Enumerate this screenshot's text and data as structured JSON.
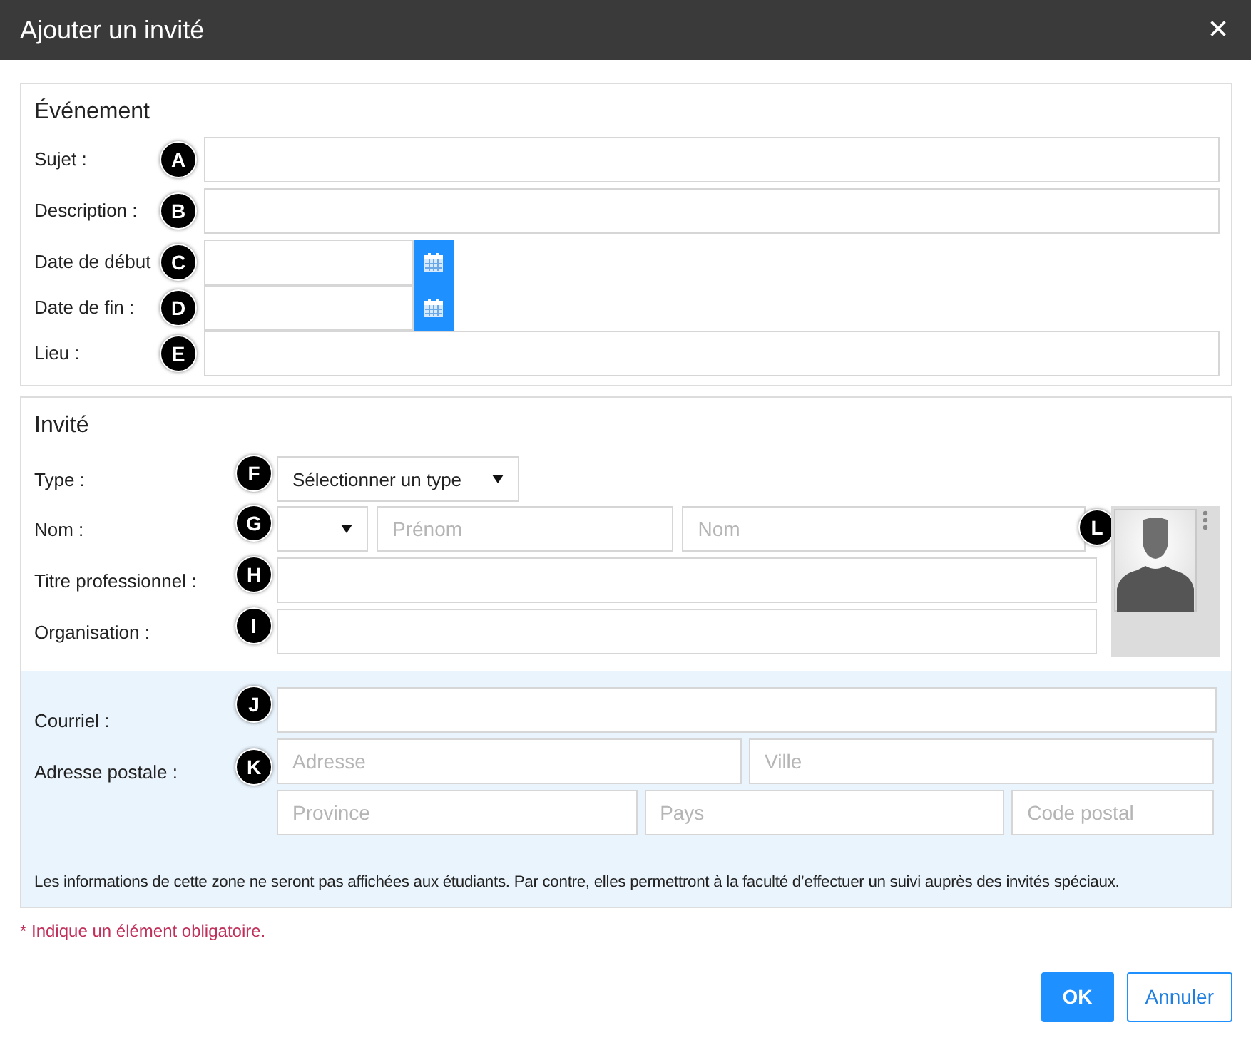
{
  "dialog": {
    "title": "Ajouter un invité",
    "close": "×"
  },
  "event": {
    "title": "Événement",
    "rows": [
      {
        "kind": "text",
        "label": "Sujet :",
        "marker": "A"
      },
      {
        "kind": "text",
        "label": "Description :",
        "marker": "B"
      },
      {
        "kind": "date",
        "label": "Date de début",
        "marker": "C"
      },
      {
        "kind": "date",
        "label": "Date de fin :",
        "marker": "D"
      },
      {
        "kind": "text",
        "label": "Lieu :",
        "marker": "E"
      }
    ]
  },
  "guest": {
    "title": "Invité",
    "type": {
      "label": "Type :",
      "marker": "F",
      "value": "Sélectionner un type"
    },
    "rows": [
      {
        "kind": "name",
        "label": "Nom :",
        "marker": "G",
        "placeholders": [
          "Prénom",
          "Nom"
        ]
      },
      {
        "kind": "text",
        "label": "Titre professionnel :",
        "marker": "H"
      },
      {
        "kind": "text",
        "label": "Organisation :",
        "marker": "I"
      }
    ],
    "photo": {
      "marker": "L"
    },
    "private": {
      "rows": [
        {
          "kind": "text",
          "label": "Courriel :",
          "marker": "J"
        },
        {
          "kind": "address",
          "label": "Adresse postale :",
          "marker": "K",
          "lines": [
            [
              {
                "placeholder": "Adresse"
              },
              {
                "placeholder": "Ville"
              }
            ],
            [
              {
                "placeholder": "Province"
              },
              {
                "placeholder": "Pays"
              },
              {
                "placeholder": "Code postal"
              }
            ]
          ]
        }
      ],
      "note": "Les informations de cette zone ne seront pas affichées aux étudiants. Par contre, elles permettront à la faculté d’effectuer un suivi auprès des invités spéciaux."
    }
  },
  "required_note": "* Indique un élément obligatoire.",
  "buttons": [
    {
      "kind": "primary",
      "label": "OK"
    },
    {
      "kind": "secondary",
      "label": "Annuler"
    }
  ]
}
